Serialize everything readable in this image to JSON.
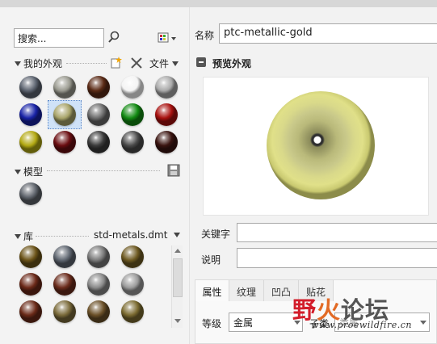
{
  "left_panel": {
    "search": {
      "placeholder": "搜索...",
      "value": ""
    },
    "my_appearances": {
      "title": "我的外观",
      "file_menu": "文件",
      "materials": [
        {
          "color": "#5d6470"
        },
        {
          "color": "#9a9a90"
        },
        {
          "color": "#5a2a15"
        },
        {
          "color": "#f4f4f4"
        },
        {
          "color": "#aaaaaa"
        },
        {
          "color": "#1822a6"
        },
        {
          "color": "#a8a46a",
          "selected": true
        },
        {
          "color": "#6c6c6c"
        },
        {
          "color": "#128a12"
        },
        {
          "color": "#a8110f"
        },
        {
          "color": "#b3a912"
        },
        {
          "color": "#6a0c10"
        },
        {
          "color": "#3a3a3a"
        },
        {
          "color": "#4a4a4a"
        },
        {
          "color": "#3a1410"
        }
      ]
    },
    "model": {
      "title": "模型",
      "materials": [
        {
          "color": "#5f646c"
        }
      ]
    },
    "library": {
      "title": "库",
      "file": "std-metals.dmt",
      "materials": [
        {
          "color": "#6b5318"
        },
        {
          "color": "#5f6670"
        },
        {
          "color": "#7a7a7a"
        },
        {
          "color": "#6e5a22"
        },
        {
          "color": "#6a2818"
        },
        {
          "color": "#6b2c1c"
        },
        {
          "color": "#8a8a8a"
        },
        {
          "color": "#9b9b9b"
        },
        {
          "color": "#6a2a18"
        },
        {
          "color": "#7a6a3a"
        },
        {
          "color": "#6a5028"
        },
        {
          "color": "#7a6a30"
        }
      ]
    }
  },
  "right_panel": {
    "name_label": "名称",
    "name_value": "ptc-metallic-gold",
    "preview_title": "预览外观",
    "keyword_label": "关键字",
    "keyword_value": "",
    "description_label": "说明",
    "description_value": "",
    "tabs": [
      {
        "label": "属性",
        "active": true
      },
      {
        "label": "纹理"
      },
      {
        "label": "凹凸"
      },
      {
        "label": "贴花"
      }
    ],
    "grade_label": "等级",
    "grade_value": "金属",
    "subclass_label": "子类",
    "subclass_value": "类属"
  },
  "watermark": {
    "text_1": "野",
    "text_2": "火",
    "text_3": "论坛",
    "url": "www.proewildfire.cn"
  }
}
